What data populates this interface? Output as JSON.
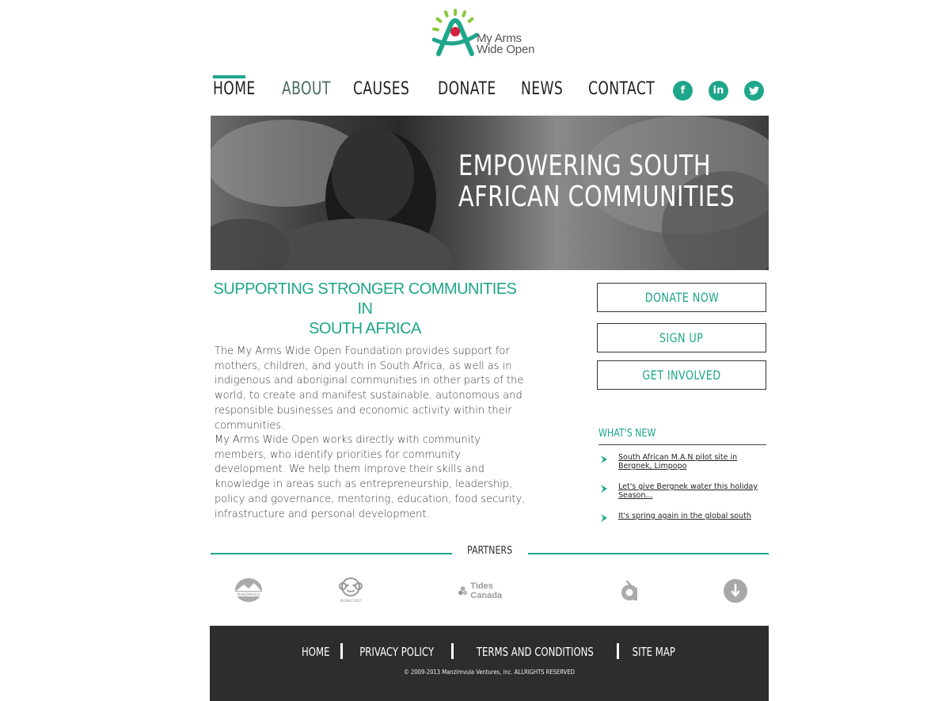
{
  "brand": {
    "logo_line1": "My Arms",
    "logo_line2": "Wide Open"
  },
  "nav": {
    "items": [
      "HOME",
      "ABOUT",
      "CAUSES",
      "DONATE",
      "NEWS",
      "CONTACT"
    ],
    "active": "HOME"
  },
  "social": {
    "icons": [
      "facebook-icon",
      "linkedin-icon",
      "twitter-icon"
    ],
    "facebook": "f",
    "linkedin": "in"
  },
  "hero": {
    "title_line1": "EMPOWERING SOUTH",
    "title_line2": "AFRICAN COMMUNITIES"
  },
  "main": {
    "heading_line1": "SUPPORTING STRONGER COMMUNITIES IN",
    "heading_line2": "SOUTH AFRICA",
    "paragraph1": " The My Arms Wide Open Foundation provides support for mothers, children, and youth in South Africa, as well as in indigenous and aboriginal communities in other parts of the world, to create and manifest sustainable, autonomous and responsible businesses and economic activity within their communities.",
    "paragraph2": "My Arms Wide Open works directly with community members, who identify priorities for community development. We help them improve their skills and knowledge in areas such as entrepreneurship, leadership, policy and governance, mentoring, education, food security, infrastructure and personal development."
  },
  "sidebar": {
    "donate_label": "DONATE NOW",
    "signup_label": "SIGN UP",
    "involved_label": "GET INVOLVED",
    "whats_new_title": "WHAT'S NEW",
    "news": [
      "South African M.A.N pilot site in Bergnek, Limpopo",
      "Let's give Bergnek water this holiday Season...",
      "It's spring again in the global south"
    ]
  },
  "partners": {
    "label": "PARTNERS",
    "tides_canada": "Tides Canada",
    "manzimvula": "MANZIMVULA",
    "monkeybiz": "MONKEYBIZ"
  },
  "footer": {
    "links": [
      "HOME",
      "PRIVACY POLICY",
      "TERMS AND CONDITIONS",
      "SITE MAP"
    ],
    "copyright": "© 2009-2013 Manzimvula Ventures, inc. ALLRIGHTS RESERVED"
  },
  "colors": {
    "accent": "#1ea68a",
    "footer_bg": "#2c2d2c",
    "logo_red": "#d4213d"
  }
}
